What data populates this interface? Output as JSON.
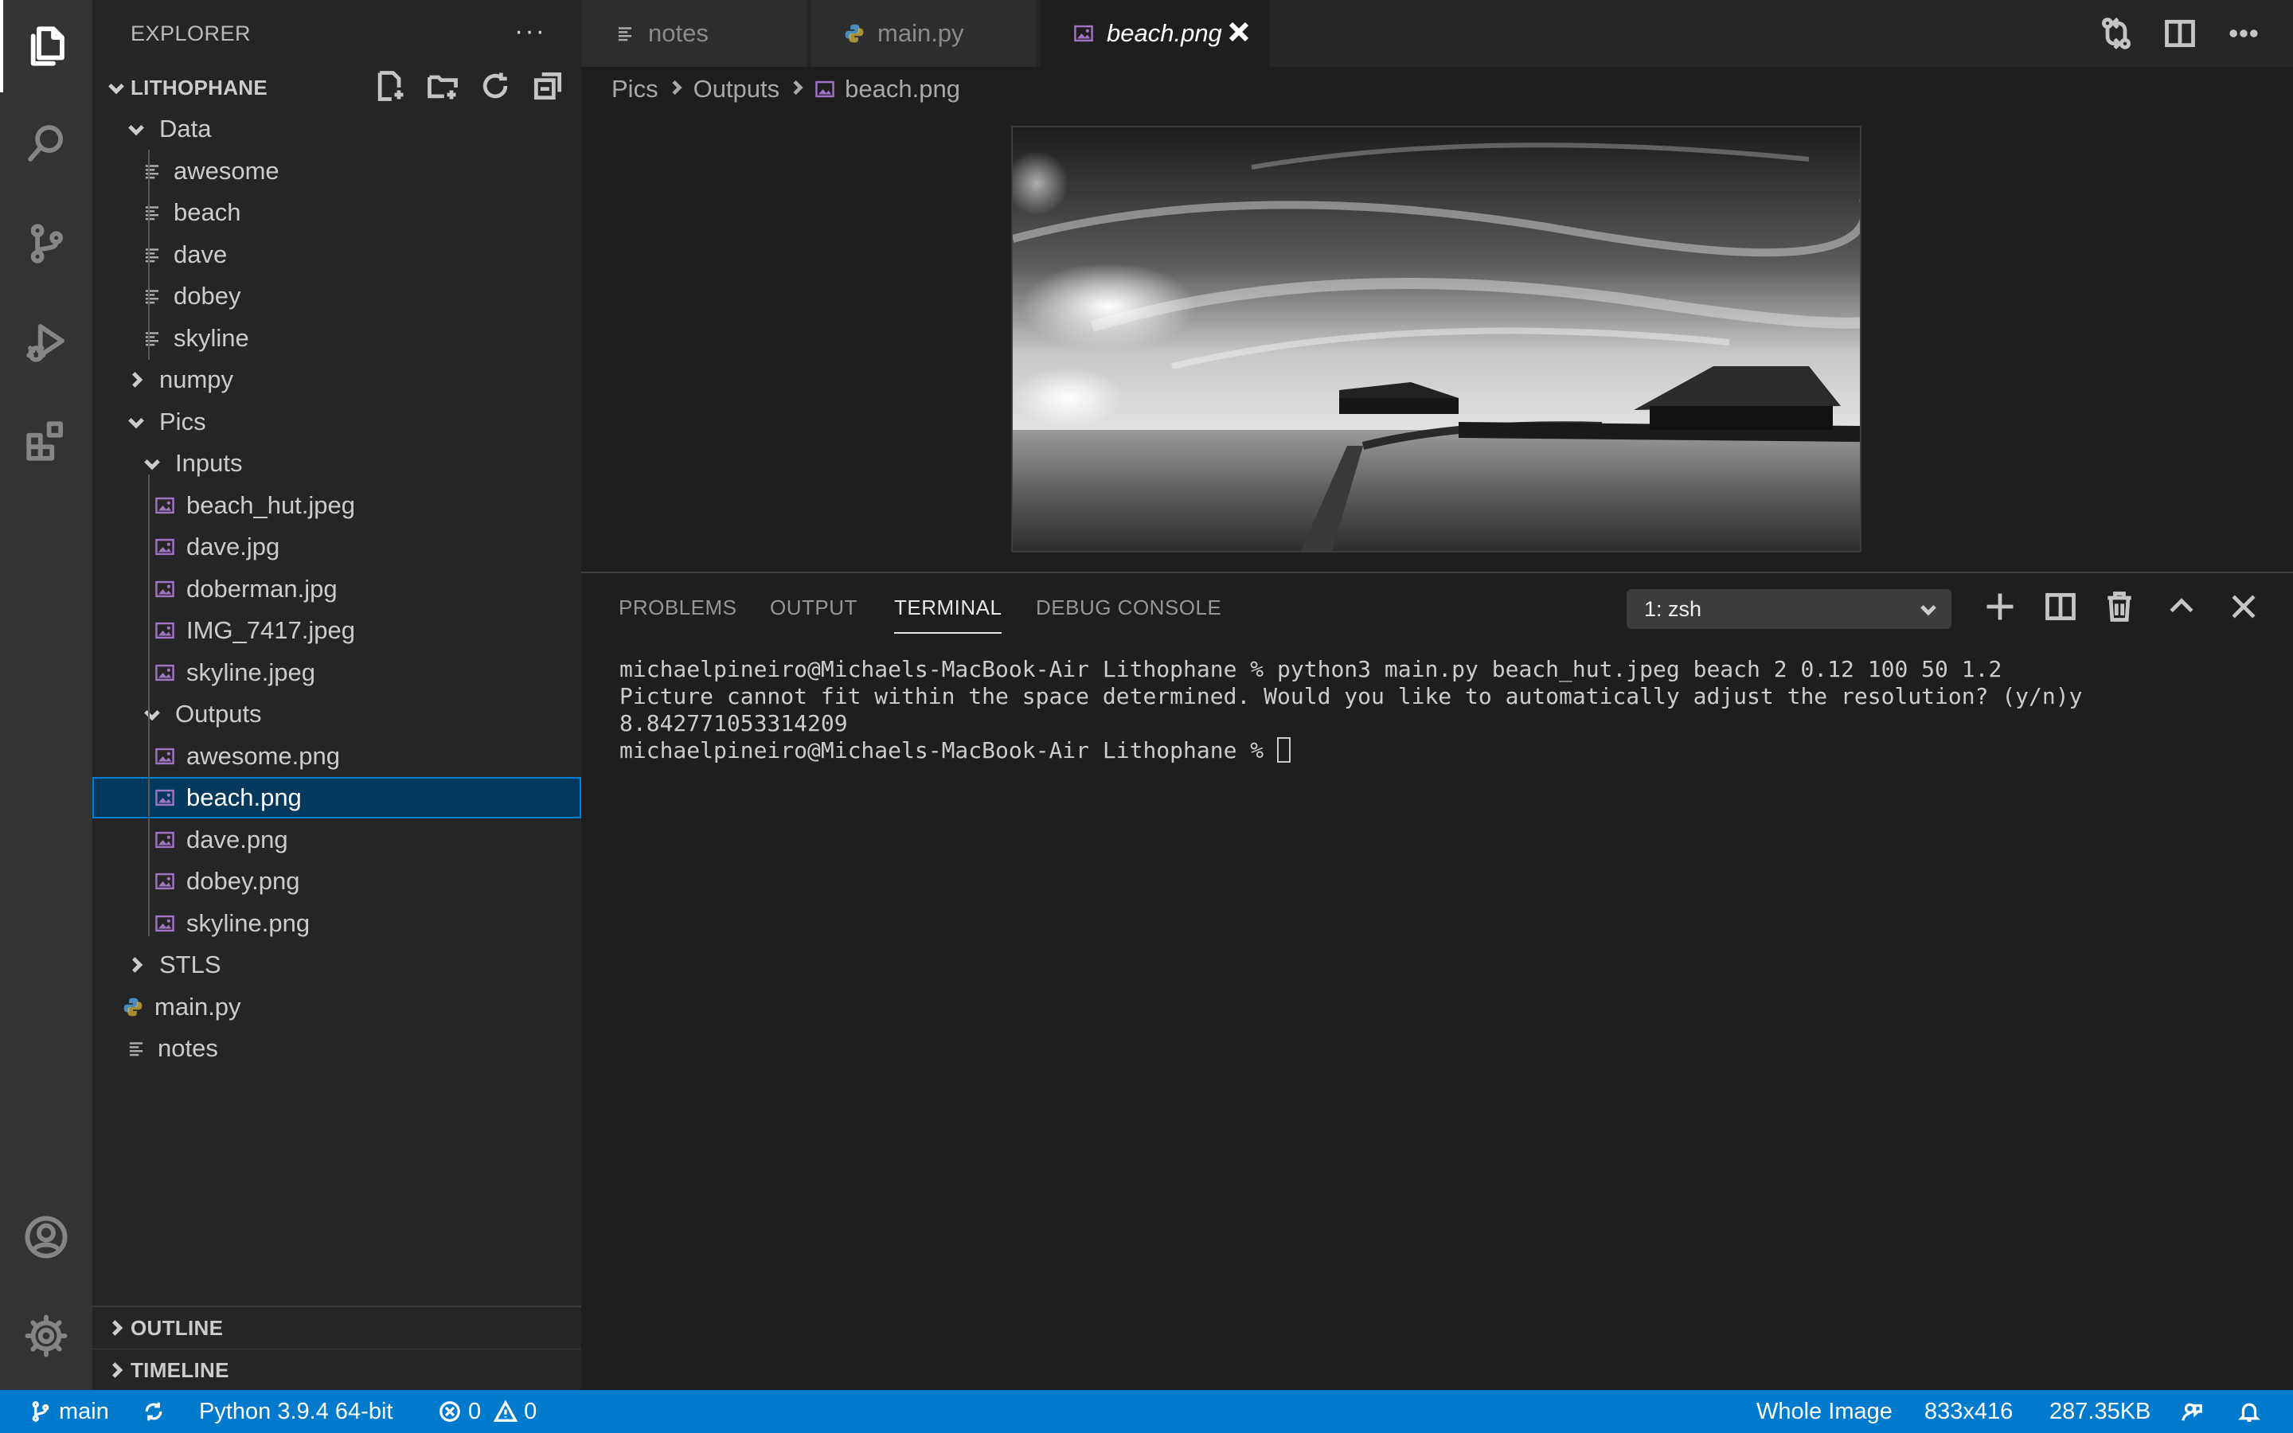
{
  "sidebar": {
    "header": "EXPLORER",
    "project": "LITHOPHANE",
    "tree": [
      {
        "label": "Data",
        "type": "folder-open"
      },
      {
        "label": "awesome",
        "type": "text"
      },
      {
        "label": "beach",
        "type": "text"
      },
      {
        "label": "dave",
        "type": "text"
      },
      {
        "label": "dobey",
        "type": "text"
      },
      {
        "label": "skyline",
        "type": "text"
      },
      {
        "label": "numpy",
        "type": "folder-closed"
      },
      {
        "label": "Pics",
        "type": "folder-open"
      },
      {
        "label": "Inputs",
        "type": "folder-open"
      },
      {
        "label": "beach_hut.jpeg",
        "type": "image"
      },
      {
        "label": "dave.jpg",
        "type": "image"
      },
      {
        "label": "doberman.jpg",
        "type": "image"
      },
      {
        "label": "IMG_7417.jpeg",
        "type": "image"
      },
      {
        "label": "skyline.jpeg",
        "type": "image"
      },
      {
        "label": "Outputs",
        "type": "folder-open"
      },
      {
        "label": "awesome.png",
        "type": "image"
      },
      {
        "label": "beach.png",
        "type": "image",
        "selected": true
      },
      {
        "label": "dave.png",
        "type": "image"
      },
      {
        "label": "dobey.png",
        "type": "image"
      },
      {
        "label": "skyline.png",
        "type": "image"
      },
      {
        "label": "STLS",
        "type": "folder-closed"
      },
      {
        "label": "main.py",
        "type": "python"
      },
      {
        "label": "notes",
        "type": "text"
      }
    ],
    "outline": "OUTLINE",
    "timeline": "TIMELINE"
  },
  "tabs": [
    {
      "label": "notes",
      "icon": "text-file-icon"
    },
    {
      "label": "main.py",
      "icon": "python-icon"
    },
    {
      "label": "beach.png",
      "icon": "image-file-icon",
      "active": true
    }
  ],
  "breadcrumb": [
    "Pics",
    "Outputs",
    "beach.png"
  ],
  "panel": {
    "tabs": [
      "PROBLEMS",
      "OUTPUT",
      "TERMINAL",
      "DEBUG CONSOLE"
    ],
    "active_tab": "TERMINAL",
    "terminal_selector": "1: zsh",
    "terminal_lines": [
      "michaelpineiro@Michaels-MacBook-Air Lithophane % python3 main.py beach_hut.jpeg beach 2 0.12 100 50 1.2",
      "Picture cannot fit within the space determined. Would you like to automatically adjust the resolution? (y/n)y",
      "8.842771053314209"
    ],
    "prompt": "michaelpineiro@Michaels-MacBook-Air Lithophane % "
  },
  "statusbar": {
    "branch": "main",
    "python": "Python 3.9.4 64-bit",
    "errors": "0",
    "warnings": "0",
    "zoom": "Whole Image",
    "dimensions": "833x416",
    "filesize": "287.35KB"
  },
  "colors": {
    "accent": "#007acc",
    "selection": "#04395e",
    "image_icon": "#a074c4",
    "python_icon": "#4b8bbe"
  }
}
